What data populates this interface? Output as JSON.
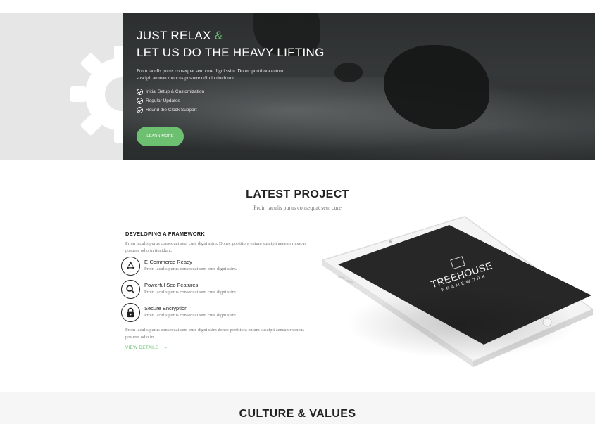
{
  "hero": {
    "title_line1_main": "JUST RELAX",
    "title_line1_amp": "&",
    "title_line2": "LET US DO THE HEAVY LIFTING",
    "description": "Proin iaculis purus consequat sem cure digni ssim. Donec porttitora entum suscipit aenean rhoncus posuere odio in tincidunt.",
    "checklist": [
      "Initial Setup & Customization",
      "Regular Updates",
      "Round the Clock Support"
    ],
    "button_label": "LEARN MORE",
    "background_icon": "gear-icon",
    "accent_color": "#6cc070"
  },
  "latest_project": {
    "title": "LATEST PROJECT",
    "subtitle": "Proin iaculis purus consequat sem cure",
    "heading": "DEVELOPING A FRAMEWORK",
    "description": "Proin iaculis purus consequat sem cure digni ssim. Donec porttitora entum suscipit aenean rhoncus posuere odio in tincidunt.",
    "features": [
      {
        "title": "E-Commerce Ready",
        "desc": "Proin iaculis purus consequat sem cure digni ssim.",
        "icon": "recycle-icon"
      },
      {
        "title": "Powerful Seo Features",
        "desc": "Proin iaculis purus consequat sem cure digni ssim.",
        "icon": "search-icon"
      },
      {
        "title": "Secure Encryption",
        "desc": "Proin iaculis purus consequat sem cure digni ssim.",
        "icon": "lock-icon"
      }
    ],
    "footer_description": "Proin iaculis purus consequat sem cure digni ssim donec porttitora entum suscipit aenean rhoncus posuere odio in.",
    "view_details_label": "VIEW DETAILS",
    "tablet": {
      "screen_title": "TREEHOUSE",
      "screen_subtitle": "FRAMEWORK"
    }
  },
  "culture": {
    "title": "CULTURE & VALUES"
  }
}
